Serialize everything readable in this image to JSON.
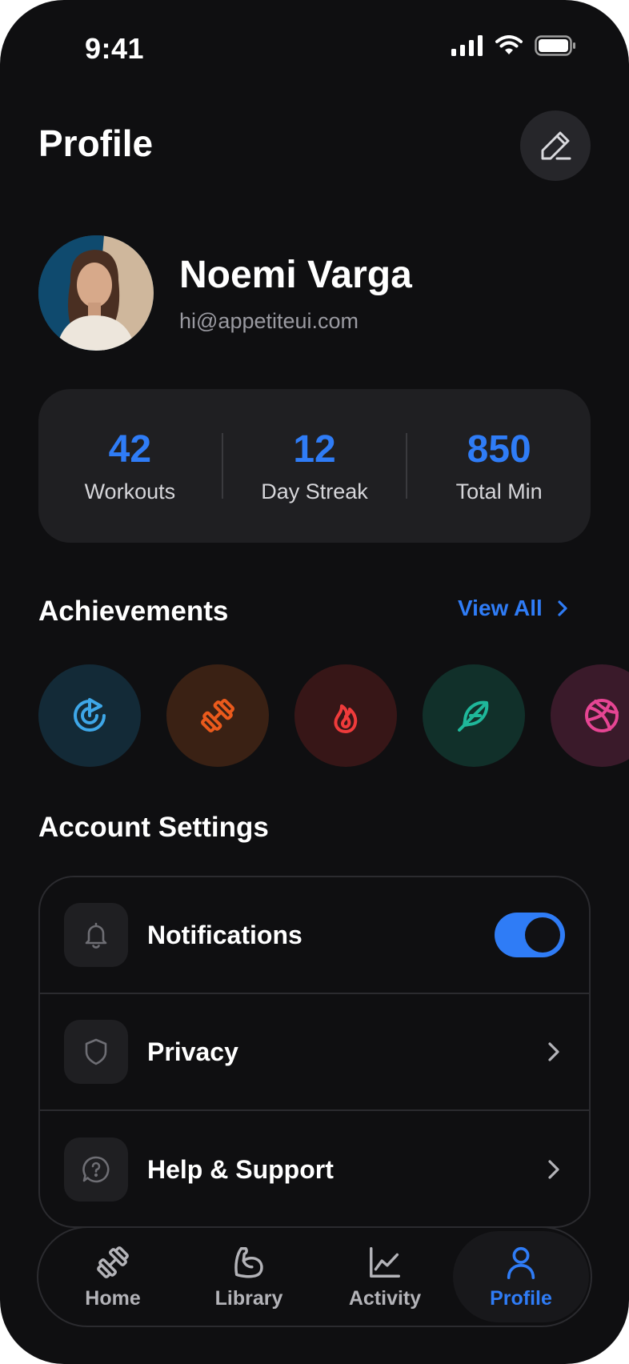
{
  "status_bar": {
    "time": "9:41"
  },
  "header": {
    "title": "Profile",
    "edit_icon": "pencil-icon"
  },
  "profile": {
    "name": "Noemi Varga",
    "email": "hi@appetiteui.com"
  },
  "stats": [
    {
      "value": "42",
      "label": "Workouts"
    },
    {
      "value": "12",
      "label": "Day Streak"
    },
    {
      "value": "850",
      "label": "Total Min"
    }
  ],
  "achievements": {
    "title": "Achievements",
    "view_all": "View All",
    "badges": [
      {
        "icon": "target-icon",
        "color": "#3ea7e8",
        "bg": "#132a37"
      },
      {
        "icon": "dumbbell-icon",
        "color": "#ea5a1c",
        "bg": "#3a2114"
      },
      {
        "icon": "flame-icon",
        "color": "#ef3b3b",
        "bg": "#371617"
      },
      {
        "icon": "feather-icon",
        "color": "#1fb79a",
        "bg": "#11302a"
      },
      {
        "icon": "basketball-icon",
        "color": "#e64593",
        "bg": "#3a1a2a"
      }
    ]
  },
  "settings": {
    "title": "Account Settings",
    "items": [
      {
        "label": "Notifications",
        "icon": "bell-icon",
        "toggle_on": true
      },
      {
        "label": "Privacy",
        "icon": "shield-icon"
      },
      {
        "label": "Help & Support",
        "icon": "help-chat-icon"
      }
    ]
  },
  "nav": [
    {
      "label": "Home",
      "icon": "dumbbell-icon",
      "active": false
    },
    {
      "label": "Library",
      "icon": "muscle-icon",
      "active": false
    },
    {
      "label": "Activity",
      "icon": "chart-icon",
      "active": false
    },
    {
      "label": "Profile",
      "icon": "user-icon",
      "active": true
    }
  ],
  "colors": {
    "accent": "#2f7cf6",
    "background": "#0f0f11",
    "card": "#1f1f22"
  }
}
